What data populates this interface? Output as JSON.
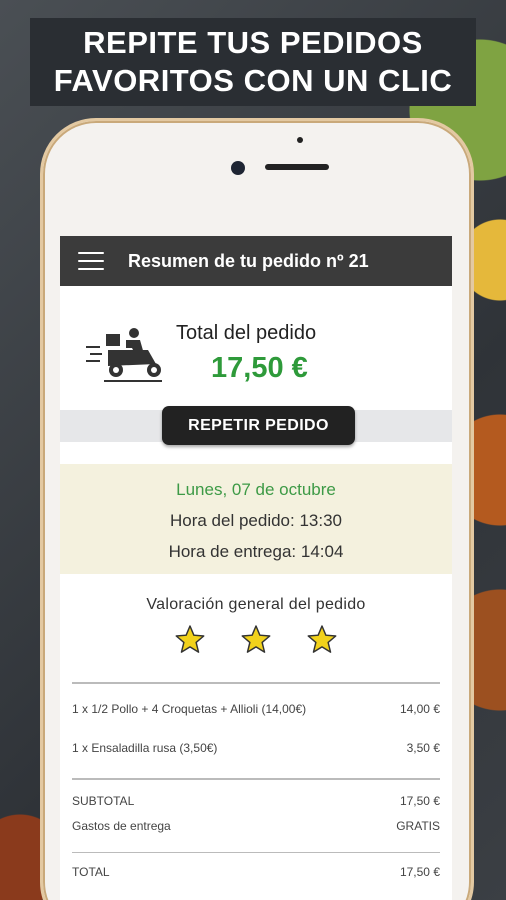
{
  "banner": {
    "line1": "REPITE TUS PEDIDOS",
    "line2": "FAVORITOS CON UN CLIC"
  },
  "header": {
    "title": "Resumen de tu pedido nº 21",
    "menu_icon": "hamburger-menu-icon"
  },
  "order": {
    "total_label": "Total del pedido",
    "total_amount": "17,50 €",
    "repeat_button": "REPETIR PEDIDO",
    "delivery_icon": "delivery-scooter-icon"
  },
  "schedule": {
    "date": "Lunes, 07 de octubre",
    "order_time": "Hora del pedido: 13:30",
    "delivery_time": "Hora de entrega: 14:04"
  },
  "rating": {
    "title": "Valoración general del pedido",
    "stars": 3,
    "max_stars": 3
  },
  "items": [
    {
      "desc": "1 x  1/2 Pollo + 4 Croquetas + Allioli (14,00€)",
      "price": "14,00 €"
    },
    {
      "desc": "1 x  Ensaladilla rusa (3,50€)",
      "price": "3,50 €"
    }
  ],
  "summary": {
    "subtotal_label": "SUBTOTAL",
    "subtotal_value": "17,50 €",
    "shipping_label": "Gastos de entrega",
    "shipping_value": "GRATIS",
    "total_label": "TOTAL",
    "total_value": "17,50 €"
  },
  "colors": {
    "accent_green": "#2e9a3a",
    "star_yellow": "#f2d21b",
    "bar_dark": "#3b3b3b",
    "date_bg": "#f4f1de"
  }
}
